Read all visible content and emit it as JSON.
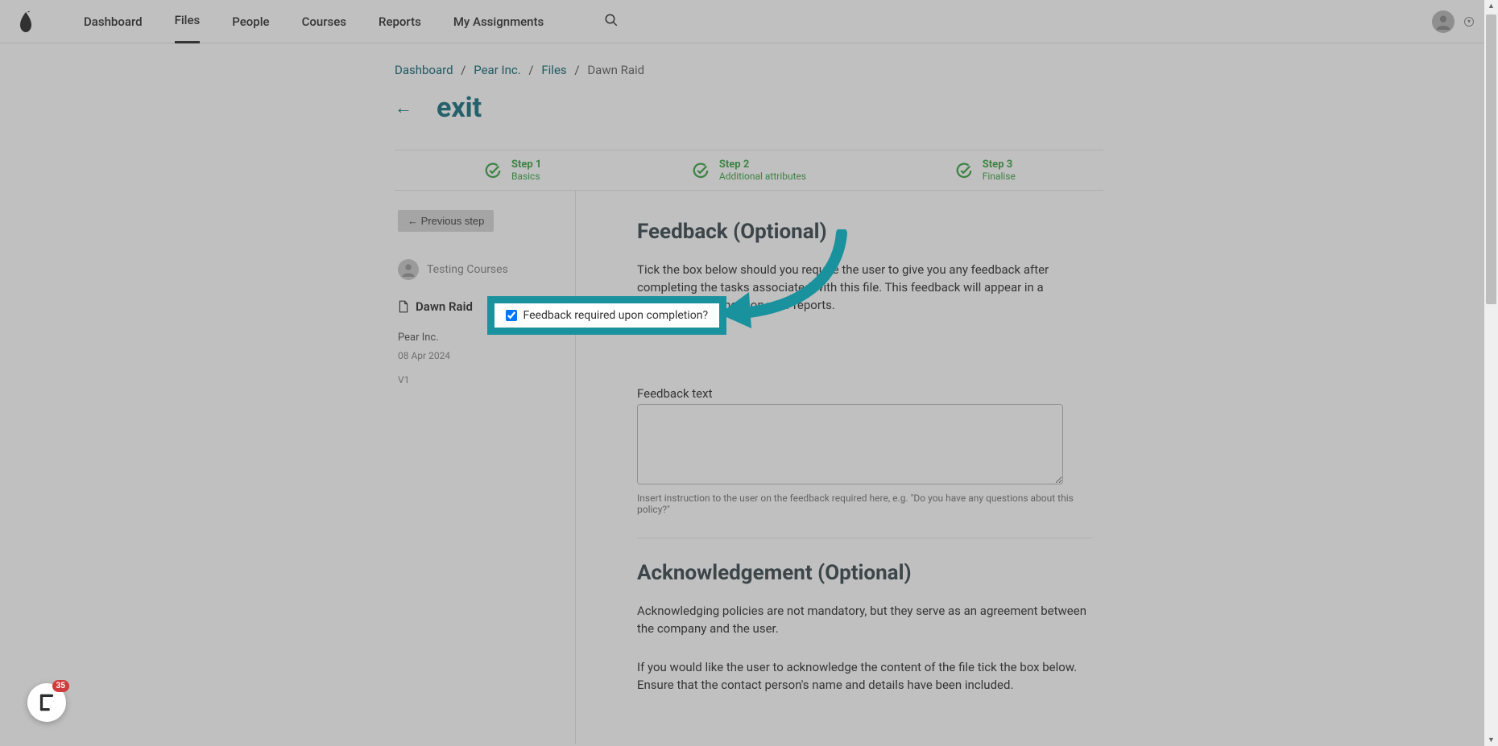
{
  "nav": {
    "items": [
      "Dashboard",
      "Files",
      "People",
      "Courses",
      "Reports",
      "My Assignments"
    ],
    "active_index": 1
  },
  "breadcrumb": {
    "items": [
      "Dashboard",
      "Pear Inc.",
      "Files",
      "Dawn Raid"
    ]
  },
  "page": {
    "title": "exit"
  },
  "steps": [
    {
      "title": "Step 1",
      "sub": "Basics"
    },
    {
      "title": "Step 2",
      "sub": "Additional attributes"
    },
    {
      "title": "Step 3",
      "sub": "Finalise"
    }
  ],
  "sidebar": {
    "prev_button": "← Previous step",
    "author": "Testing Courses",
    "file_name": "Dawn Raid",
    "company": "Pear Inc.",
    "date": "08 Apr 2024",
    "version": "V1"
  },
  "feedback": {
    "heading": "Feedback (Optional)",
    "description": "Tick the box below should you require the user to give you any feedback after completing the tasks associated with this file. This feedback will appear in a separate excel sheet on your reports.",
    "checkbox_label": "Feedback required upon completion?",
    "checkbox_checked": true,
    "textarea_label": "Feedback text",
    "helper": "Insert instruction to the user on the feedback required here, e.g. \"Do you have any questions about this policy?\""
  },
  "ack": {
    "heading": "Acknowledgement (Optional)",
    "p1": "Acknowledging policies are not mandatory, but they serve as an agreement between the company and the user.",
    "p2": "If you would like the user to acknowledge the content of the file tick the box below. Ensure that the contact person's name and details have been included."
  },
  "widget": {
    "count": "35"
  }
}
